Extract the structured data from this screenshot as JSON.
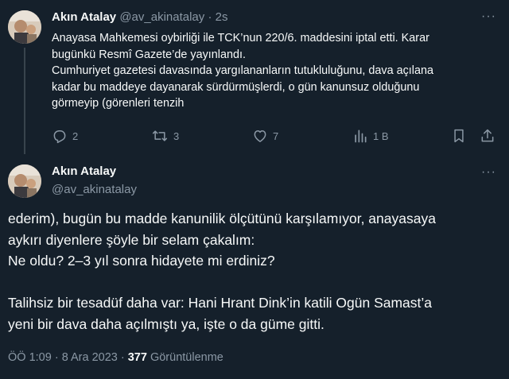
{
  "tweet1": {
    "author_name": "Akın Atalay",
    "handle": "@av_akinatalay",
    "separator": "·",
    "time": "2s",
    "more": "···",
    "lines": [
      "Anayasa Mahkemesi oybirliği ile TCK’nun 220/6. maddesini iptal etti. Karar",
      "bugünkü Resmî Gazete’de yayınlandı.",
      "Cumhuriyet gazetesi davasında yargılananların tutukluluğunu, dava açılana",
      "kadar bu maddeye dayanarak sürdürmüşlerdi, o gün kanunsuz olduğunu",
      "görmeyip (görenleri tenzih"
    ],
    "actions": {
      "replies": "2",
      "retweets": "3",
      "likes": "7",
      "views": "1 B"
    },
    "icons": [
      "reply-icon",
      "retweet-icon",
      "like-icon",
      "views-icon",
      "bookmark-icon",
      "share-icon"
    ]
  },
  "tweet2": {
    "author_name": "Akın Atalay",
    "handle": "@av_akinatalay",
    "more": "···",
    "lines": [
      "ederim), bugün bu madde kanunilik ölçütünü karşılamıyor, anayasaya",
      "aykırı diyenlere şöyle bir selam çakalım:",
      "Ne oldu? 2–3 yıl sonra hidayete mi erdiniz?",
      "",
      "Talihsiz bir tesadüf daha var: Hani Hrant Dink’in katili Ogün Samast’a",
      "yeni bir dava daha açılmıştı ya, işte o da güme gitti."
    ],
    "meta_time": "ÖÖ 1:09 · 8 Ara 2023 ·",
    "views_count": "377",
    "views_label": "Görüntülenme"
  },
  "colors": {
    "background": "#15202b",
    "text": "#f7f9f9",
    "muted": "#8b98a5",
    "thread_line": "#38444d"
  }
}
